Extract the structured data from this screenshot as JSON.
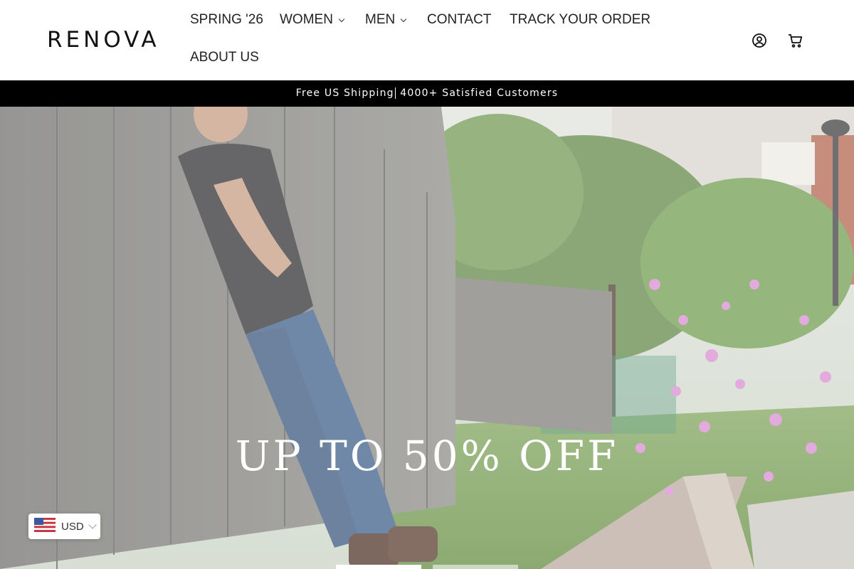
{
  "brand": {
    "logo": "RENOVA"
  },
  "nav": {
    "items": [
      {
        "label": "SPRING '26",
        "has_dropdown": false
      },
      {
        "label": "WOMEN",
        "has_dropdown": true
      },
      {
        "label": "MEN",
        "has_dropdown": true
      },
      {
        "label": "CONTACT",
        "has_dropdown": false
      },
      {
        "label": "TRACK YOUR ORDER",
        "has_dropdown": false
      },
      {
        "label": "ABOUT US",
        "has_dropdown": false
      }
    ]
  },
  "header_icons": {
    "account": "account-icon",
    "cart": "cart-icon"
  },
  "announcement": {
    "left": "Free US Shipping",
    "right": "4000+ Satisfied Customers"
  },
  "hero": {
    "headline": "UP TO 50% OFF",
    "slide_count": 2,
    "active_slide": 1
  },
  "currency": {
    "code": "USD",
    "flag": "us-flag-icon"
  },
  "colors": {
    "announcement_bg": "#000000",
    "text": "#111111",
    "background": "#ffffff"
  }
}
